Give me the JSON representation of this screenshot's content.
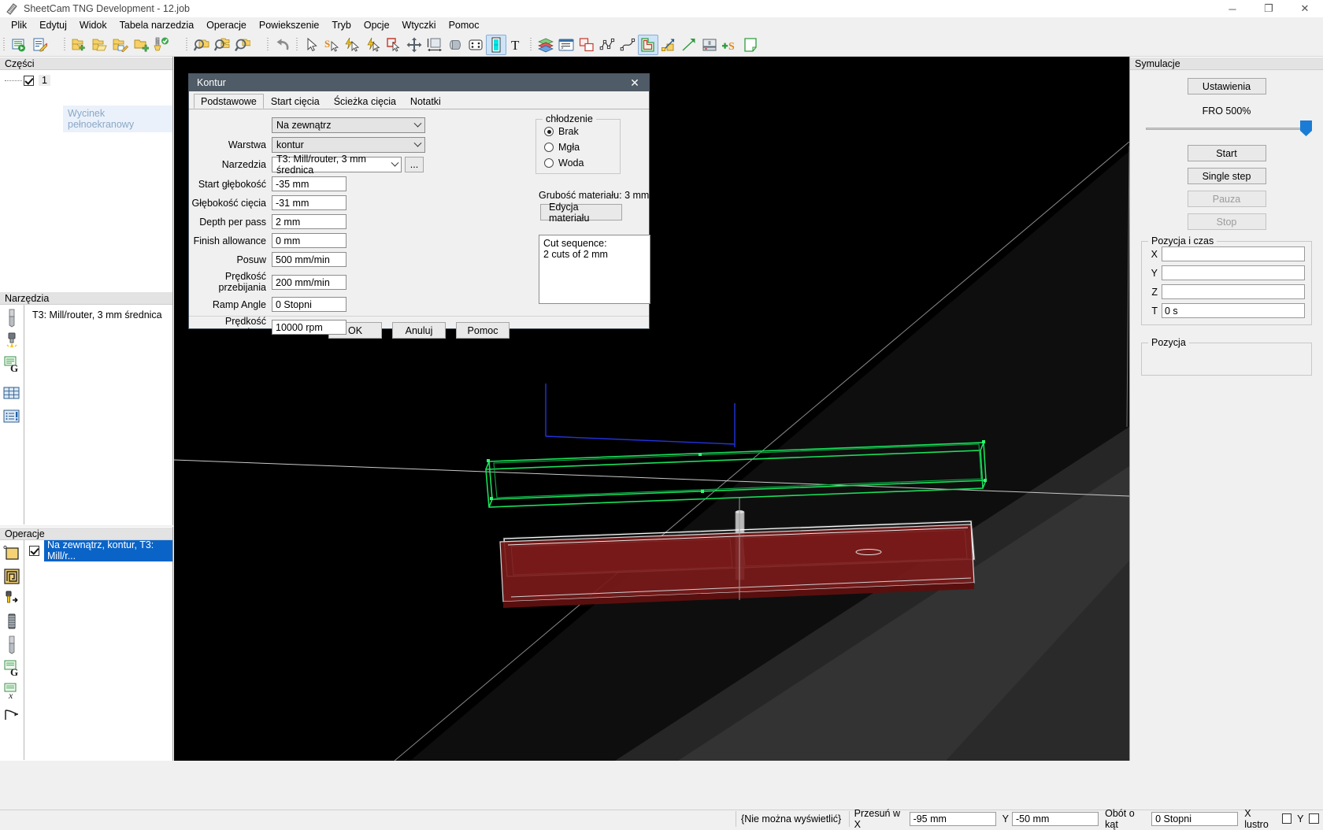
{
  "window": {
    "title": "SheetCam TNG Development - 12.job",
    "icon": "sheetcam-logo-icon",
    "minimize": "─",
    "maximize": "❐",
    "close": "✕"
  },
  "menubar": {
    "items": [
      {
        "label": "Plik",
        "name": "menu-plik"
      },
      {
        "label": "Edytuj",
        "name": "menu-edytuj"
      },
      {
        "label": "Widok",
        "name": "menu-widok"
      },
      {
        "label": "Tabela narzedzia",
        "name": "menu-tabela-narzedzia"
      },
      {
        "label": "Operacje",
        "name": "menu-operacje"
      },
      {
        "label": "Powiekszenie",
        "name": "menu-powiekszenie"
      },
      {
        "label": "Tryb",
        "name": "menu-tryb"
      },
      {
        "label": "Opcje",
        "name": "menu-opcje"
      },
      {
        "label": "Wtyczki",
        "name": "menu-wtyczki"
      },
      {
        "label": "Pomoc",
        "name": "menu-pomoc"
      }
    ]
  },
  "toolbar": {
    "groups": [
      {
        "icons": [
          "run-post-processor-icon",
          "edit-job-icon"
        ]
      },
      {
        "icons": [
          "new-job-icon",
          "open-job-icon",
          "edit-part-icon",
          "add-part-icon",
          "tool-library-icon"
        ]
      },
      {
        "icons": [
          "zoom-part-icon",
          "zoom-extents-icon",
          "zoom-window-icon"
        ]
      },
      {
        "icons": [
          "undo-icon"
        ]
      },
      {
        "icons": [
          "select-arrow-icon",
          "snap-select-icon",
          "quick-snap-icon",
          "node-snap-icon",
          "contour-select-icon",
          "pan-icon",
          "measure-icon",
          "rotate-icon",
          "array-icon",
          "toggle-layer-icon",
          "text-tool-icon"
        ]
      },
      {
        "icons": [
          "layers-icon",
          "code-view-icon",
          "duplicate-shape-icon",
          "polyline-icon",
          "spline-icon",
          "offset-icon",
          "lead-in-icon",
          "lead-line-icon",
          "machine-icon",
          "add-s-icon",
          "note-icon"
        ]
      }
    ]
  },
  "parts_panel": {
    "header": "Części",
    "items": [
      {
        "label": "1",
        "checked": true,
        "name": "part-item-1"
      }
    ],
    "tooltip": "Wycinek pełnoekranowy"
  },
  "tools_panel": {
    "header": "Narzędzia",
    "rail_icons": [
      "mill-router-icon",
      "plasma-tool-icon",
      "gcode-tool-icon",
      "tool-table-icon",
      "tool-list-icon"
    ],
    "items": [
      {
        "label": "T3: Mill/router, 3 mm średnica",
        "name": "tool-item-t3"
      }
    ]
  },
  "operations_panel": {
    "header": "Operacje",
    "rail_icons": [
      "outside-offset-icon",
      "pocket-icon",
      "drill-icon",
      "tap-icon",
      "mill-icon",
      "gcode-op-icon",
      "variable-op-icon",
      "move-op-icon"
    ],
    "items": [
      {
        "label": "Na zewnątrz, kontur, T3: Mill/r...",
        "checked": true,
        "selected": true,
        "name": "operation-item-contour"
      }
    ]
  },
  "simulation_panel": {
    "header": "Symulacje",
    "settings_button": "Ustawienia",
    "fro_label": "FRO 500%",
    "fro_value": 500,
    "buttons": [
      {
        "label": "Start",
        "enabled": true,
        "name": "sim-start-button"
      },
      {
        "label": "Single step",
        "enabled": true,
        "name": "sim-single-step-button"
      },
      {
        "label": "Pauza",
        "enabled": false,
        "name": "sim-pause-button"
      },
      {
        "label": "Stop",
        "enabled": false,
        "name": "sim-stop-button"
      }
    ],
    "position_time": {
      "title": "Pozycja i czas",
      "fields": [
        {
          "label": "X",
          "value": ""
        },
        {
          "label": "Y",
          "value": ""
        },
        {
          "label": "Z",
          "value": ""
        },
        {
          "label": "T",
          "value": "0 s"
        }
      ]
    },
    "position": {
      "title": "Pozycja"
    }
  },
  "dialog": {
    "title": "Kontur",
    "close_glyph": "✕",
    "tabs": [
      {
        "label": "Podstawowe",
        "selected": true,
        "name": "tab-podstawowe"
      },
      {
        "label": "Start cięcia",
        "selected": false,
        "name": "tab-start-ciecia"
      },
      {
        "label": "Ścieżka cięcia",
        "selected": false,
        "name": "tab-sciezka-ciecia"
      },
      {
        "label": "Notatki",
        "selected": false,
        "name": "tab-notatki"
      }
    ],
    "offset_side": {
      "label": "",
      "value": "Na zewnątrz"
    },
    "layer": {
      "label": "Warstwa",
      "value": "kontur"
    },
    "tool": {
      "label": "Narzedzia",
      "value": "T3: Mill/router, 3 mm średnica",
      "browse": "..."
    },
    "fields": [
      {
        "label": "Start głębokość",
        "value": "-35 mm",
        "name": "start-depth-field"
      },
      {
        "label": "Głębokość cięcia",
        "value": "-31 mm",
        "name": "cut-depth-field"
      },
      {
        "label": "Depth per pass",
        "value": "2 mm",
        "name": "depth-per-pass-field"
      },
      {
        "label": "Finish allowance",
        "value": "0 mm",
        "name": "finish-allowance-field"
      },
      {
        "label": "Posuw",
        "value": "500 mm/min",
        "name": "feed-rate-field"
      },
      {
        "label": "Prędkość przebijania",
        "value": "200 mm/min",
        "name": "plunge-rate-field"
      },
      {
        "label": "Ramp Angle",
        "value": "0 Stopni",
        "name": "ramp-angle-field"
      },
      {
        "label": "Prędkość wrzeciona",
        "value": "10000 rpm",
        "name": "spindle-speed-field"
      }
    ],
    "coolant": {
      "title": "chłodzenie",
      "options": [
        {
          "label": "Brak",
          "selected": true,
          "name": "coolant-none-radio"
        },
        {
          "label": "Mgła",
          "selected": false,
          "name": "coolant-mist-radio"
        },
        {
          "label": "Woda",
          "selected": false,
          "name": "coolant-flood-radio"
        }
      ]
    },
    "material": {
      "thickness_label": "Grubość materiału: 3 mm",
      "edit_button": "Edycja materiału"
    },
    "cut_sequence": "Cut sequence:\n2 cuts of 2 mm",
    "buttons": [
      {
        "label": "OK",
        "name": "dialog-ok-button"
      },
      {
        "label": "Anuluj",
        "name": "dialog-cancel-button"
      },
      {
        "label": "Pomoc",
        "name": "dialog-help-button"
      }
    ]
  },
  "statusbar": {
    "message": "{Nie można wyświetlić}",
    "move_x_label": "Przesuń w X",
    "move_x_value": "-95 mm",
    "move_y_label": "Y",
    "move_y_value": "-50 mm",
    "rotate_label": "Obót o kąt",
    "rotate_value": "0 Stopni",
    "mirror_x_label": "X lustro",
    "mirror_y_label": "Y"
  },
  "colors": {
    "accent": "#0a64c8",
    "dialog_title_bg": "#4f5b66",
    "slider_thumb": "#1b7cd6",
    "toolpath_green": "#00d54b",
    "material_red": "#7a1a1a"
  }
}
